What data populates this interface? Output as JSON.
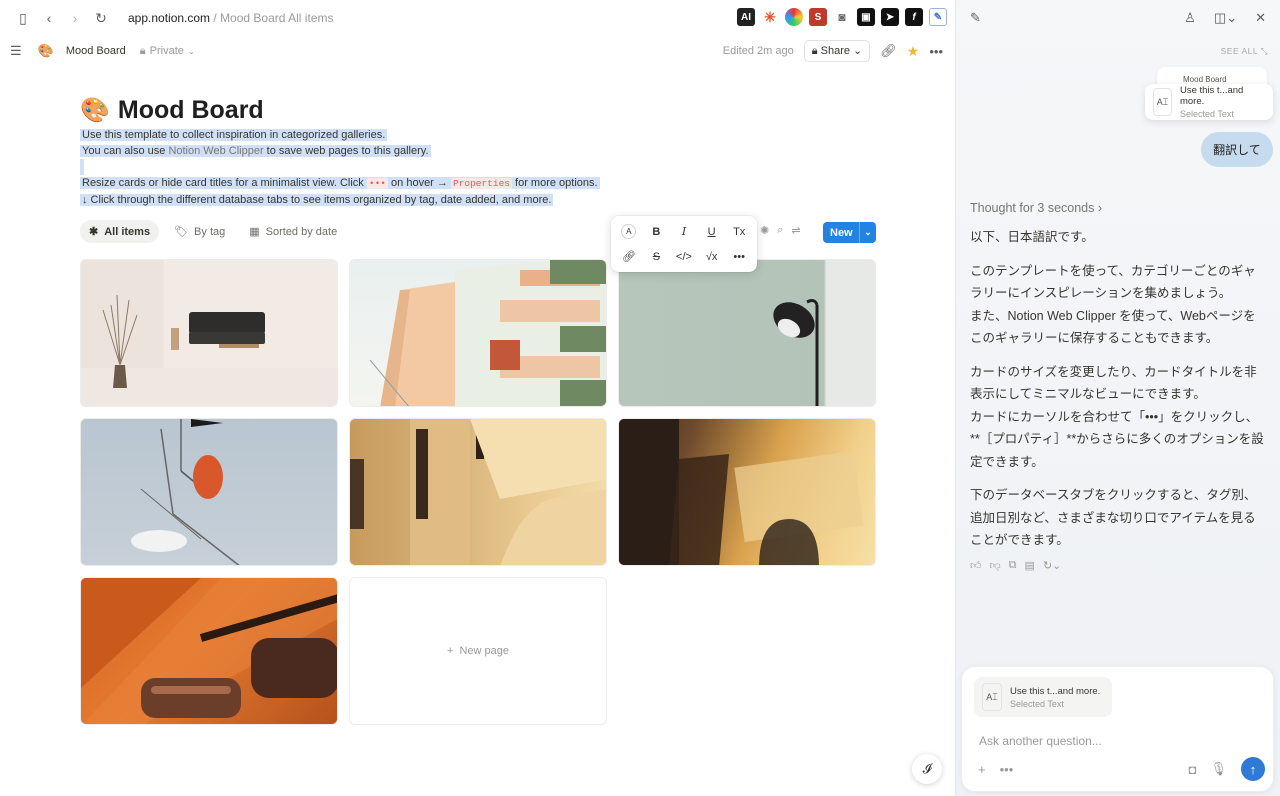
{
  "browser": {
    "url_host": "app.notion.com",
    "url_path": " / Mood Board All items"
  },
  "header": {
    "page_icon": "🎨",
    "page_title": "Mood Board",
    "privacy": "Private",
    "edited": "Edited 2m ago",
    "share": "Share"
  },
  "page": {
    "title": "Mood Board",
    "title_icon": "🎨",
    "line1": "Use this template to collect inspiration in categorized galleries.",
    "line2_pre": "You can also use ",
    "line2_link": "Notion Web Clipper",
    "line2_post": " to save web pages to this gallery.",
    "line3_pre": "Resize cards or hide card titles for a minimalist view. Click ",
    "line3_code1": "•••",
    "line3_mid": " on hover → ",
    "line3_code2": "Properties",
    "line3_post": " for more options.",
    "line4": "↓ Click through the different database tabs to see items organized by tag, date added, and more."
  },
  "views": {
    "tabs": [
      {
        "label": "All items",
        "icon": "asterisk-icon"
      },
      {
        "label": "By tag",
        "icon": "tag-icon"
      },
      {
        "label": "Sorted by date",
        "icon": "calendar-icon"
      }
    ],
    "new_label": "New"
  },
  "format_toolbar": {
    "items": [
      "A",
      "B",
      "I",
      "U",
      "Tx",
      "link",
      "strikethrough",
      "code",
      "equation",
      "more"
    ]
  },
  "gallery": {
    "new_page_label": "New page"
  },
  "panel": {
    "see_all": "SEE ALL",
    "context_ghost": "Mood Board",
    "context_title": "Use this t...and more.",
    "context_sub": "Selected Text",
    "user_message": "翻訳して",
    "thought": "Thought for 3 seconds",
    "answer": [
      "以下、日本語訳です。",
      "このテンプレートを使って、カテゴリーごとのギャラリーにインスピレーションを集めましょう。\nまた、Notion Web Clipper を使って、Webページをこのギャラリーに保存することもできます。",
      "カードのサイズを変更したり、カードタイトルを非表示にしてミニマルなビューにできます。\nカードにカーソルを合わせて「•••」をクリックし、**［プロパティ］**からさらに多くのオプションを設定できます。",
      "下のデータベースタブをクリックすると、タグ別、追加日別など、さまざまな切り口でアイテムを見ることができます。"
    ],
    "composer_placeholder": "Ask another question..."
  }
}
